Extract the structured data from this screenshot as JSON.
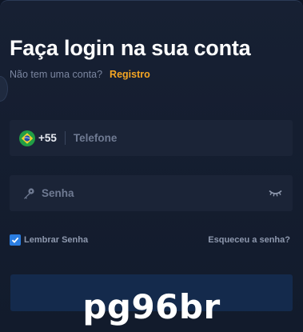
{
  "login": {
    "title": "Faça login na sua conta",
    "no_account_text": "Não tem uma conta?",
    "register_link": "Registro"
  },
  "phone_field": {
    "country_code": "+55",
    "flag": "brazil-flag-icon",
    "placeholder": "Telefone",
    "value": ""
  },
  "password_field": {
    "icon": "key-icon",
    "placeholder": "Senha",
    "value": "",
    "toggle_icon": "eye-closed-icon"
  },
  "remember": {
    "label": "Lembrar Senha",
    "checked": true
  },
  "forgot_link": "Esqueceu a senha?",
  "watermark": "pg96br",
  "colors": {
    "background": "#121b2c",
    "field": "#1b2437",
    "accent_orange": "#f5a623",
    "checkbox_blue": "#2a7de1",
    "button": "#142a4c"
  }
}
